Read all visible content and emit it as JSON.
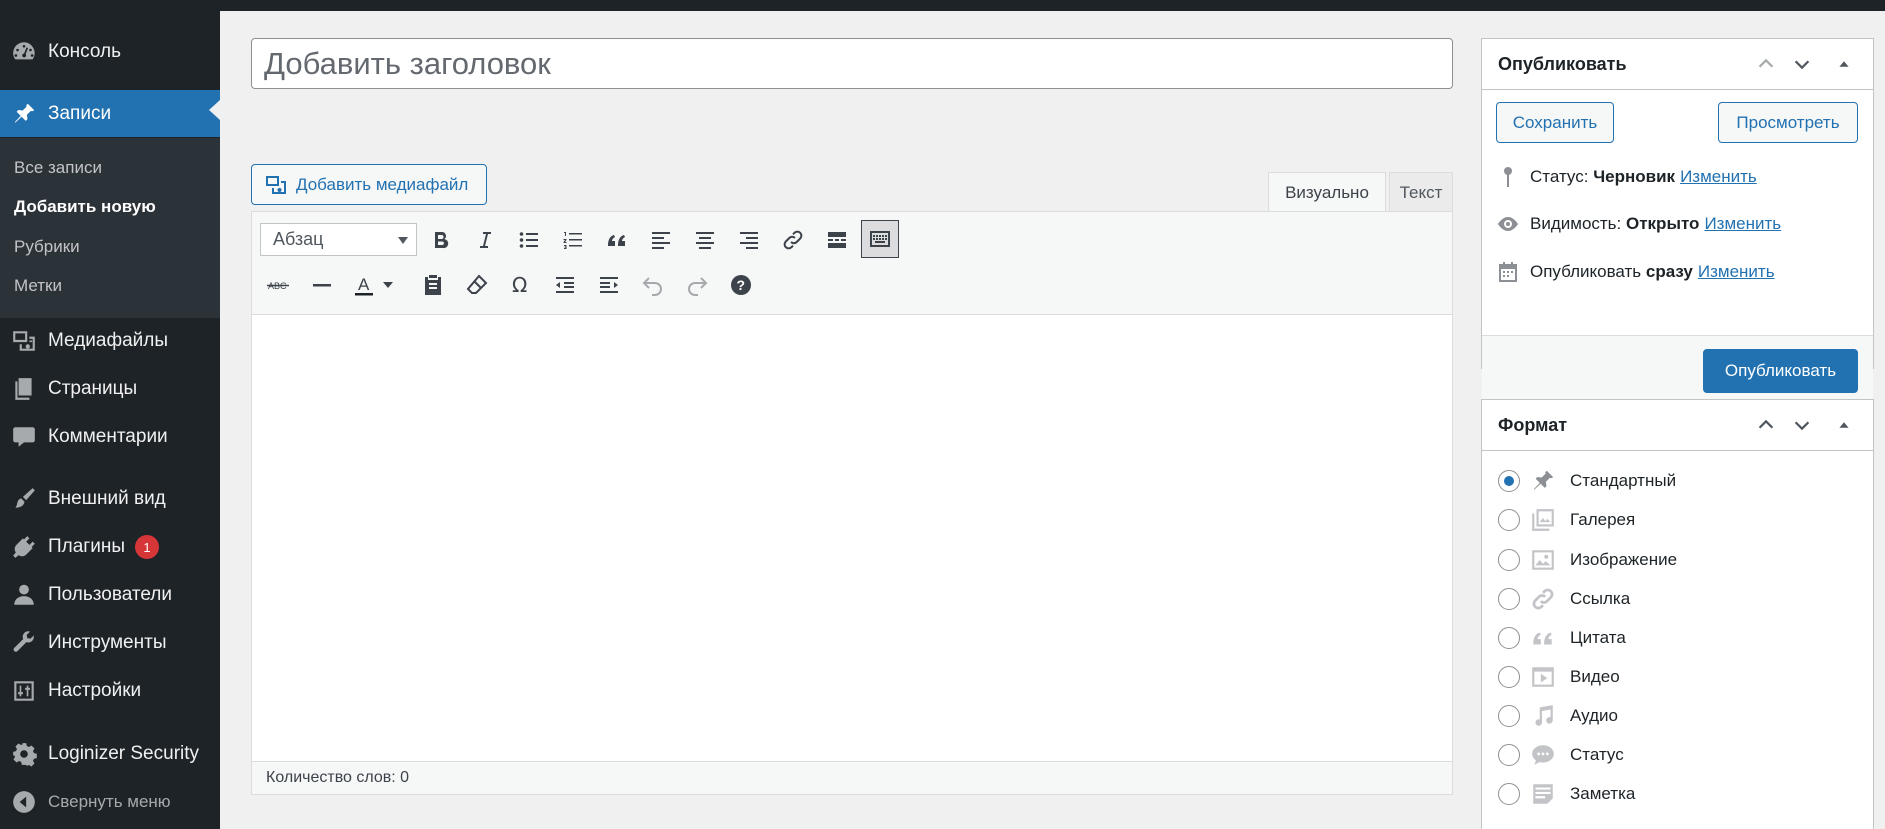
{
  "sidebar": {
    "dashboard": "Консоль",
    "posts": "Записи",
    "submenu": [
      "Все записи",
      "Добавить новую",
      "Рубрики",
      "Метки"
    ],
    "media": "Медиафайлы",
    "pages": "Страницы",
    "comments": "Комментарии",
    "appearance": "Внешний вид",
    "plugins": "Плагины",
    "plugins_badge": "1",
    "users": "Пользователи",
    "tools": "Инструменты",
    "settings": "Настройки",
    "loginizer": "Loginizer Security",
    "collapse": "Свернуть меню"
  },
  "editor": {
    "title_placeholder": "Добавить заголовок",
    "add_media": "Добавить медиафайл",
    "tab_visual": "Визуально",
    "tab_text": "Текст",
    "format_select": "Абзац",
    "word_count": "Количество слов: 0"
  },
  "publish_box": {
    "title": "Опубликовать",
    "save": "Сохранить",
    "preview": "Просмотреть",
    "status_label": "Статус:",
    "status_value": "Черновик",
    "visibility_label": "Видимость:",
    "visibility_value": "Открыто",
    "schedule_label": "Опубликовать",
    "schedule_value": "сразу",
    "edit_link": "Изменить",
    "publish": "Опубликовать"
  },
  "format_box": {
    "title": "Формат",
    "selected": "Стандартный",
    "options": [
      "Стандартный",
      "Галерея",
      "Изображение",
      "Ссылка",
      "Цитата",
      "Видео",
      "Аудио",
      "Статус",
      "Заметка"
    ]
  },
  "colors": {
    "admin_dark": "#1d2327",
    "accent": "#2271b1",
    "badge": "#d63638"
  }
}
